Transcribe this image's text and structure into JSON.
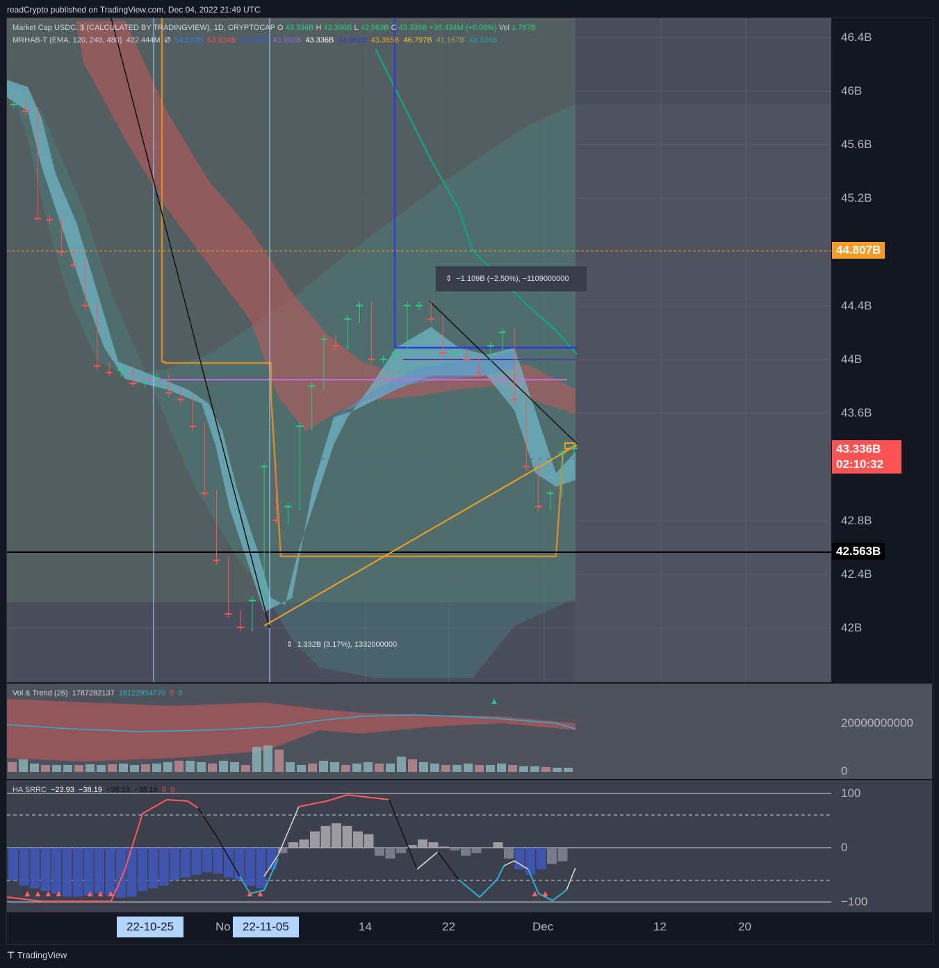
{
  "header": {
    "publisher": "readCrypto published on TradingView.com, Dec 04, 2022 21:49 UTC"
  },
  "legend1": {
    "symbol": "Market Cap USDC, $ (CALCULATED BY TRADINGVIEW), 1D, CRYPTOCAP",
    "o_label": "O",
    "o": "43.336B",
    "h_label": "H",
    "h": "43.336B",
    "l_label": "L",
    "l": "42.963B",
    "c_label": "C",
    "c": "43.336B",
    "change": "+36.434M (+0.08%)",
    "vol_label": "Vol",
    "vol": "1.787B"
  },
  "legend2": {
    "name": "MRHAB-T (EMA, 120, 240, 480)",
    "v1": "422.444M",
    "v1b": "Ø",
    "v2": "54.233B",
    "v3": "53.824B",
    "v4": "43.385B",
    "v5": "43.993B",
    "v6": "43.336B",
    "v7": "44.082B",
    "v8": "43.365B",
    "v9": "46.797B",
    "v10": "41.167B",
    "v11": "43.336B"
  },
  "legend3": {
    "name": "Vol & Trend (26)",
    "a": "1787282137",
    "b": "18122954770",
    "c": "0",
    "d": "0"
  },
  "legend4": {
    "name": "HA SRRC",
    "a": "−23.93",
    "b": "−38.19",
    "c": "−38.19",
    "d": "−38.19",
    "e": "0",
    "f": "0"
  },
  "price_axis": [
    "46.4B",
    "46B",
    "45.6B",
    "45.2B",
    "44.4B",
    "44B",
    "43.6B",
    "42.8B",
    "42.4B",
    "42B"
  ],
  "price_labels": {
    "orange": "44.807B",
    "current": "43.336B",
    "countdown": "02:10:32",
    "black": "42.563B"
  },
  "vol_axis": {
    "top": "20000000000",
    "bottom": "0"
  },
  "osc_axis": {
    "top": "100",
    "mid": "0",
    "bottom": "−100"
  },
  "time_axis": [
    "No",
    "14",
    "22",
    "Dec",
    "12",
    "20"
  ],
  "date_labels": [
    "22-10-25",
    "22-11-05"
  ],
  "measure_top": "−1.109B (−2.50%), −1109000000",
  "measure_bottom": "1.332B (3.17%), 1332000000",
  "footer": "TradingView",
  "colors": {
    "bg": "#131722",
    "pane": "#4a4e5c",
    "up": "#26a69a",
    "down": "#ef5350",
    "orange": "#f59a23",
    "blue": "#2f3bd9",
    "magenta": "#c36bd8",
    "teal_band": "#6fb6c4"
  },
  "chart_data": {
    "type": "candlestick",
    "title": "Market Cap USDC, $ (CALCULATED BY TRADINGVIEW), 1D, CRYPTOCAP",
    "ylim": [
      41.7,
      46.6
    ],
    "close_series": [
      45.9,
      45.85,
      45.05,
      45.04,
      44.8,
      44.7,
      44.4,
      43.95,
      43.9,
      43.92,
      43.82,
      43.83,
      43.86,
      43.75,
      43.7,
      43.5,
      43.0,
      42.5,
      42.1,
      42.0,
      42.2,
      43.2,
      42.8,
      42.9,
      43.5,
      43.8,
      44.15,
      44.1,
      44.3,
      44.4,
      44.0,
      44.0,
      44.05,
      44.4,
      44.4,
      44.3,
      44.05,
      44.05,
      44.0,
      43.9,
      44.1,
      44.2,
      43.7,
      43.2,
      42.9,
      43.0,
      43.3,
      43.336
    ],
    "last_close": 43.336,
    "resistance": 44.807,
    "support": 42.563
  }
}
